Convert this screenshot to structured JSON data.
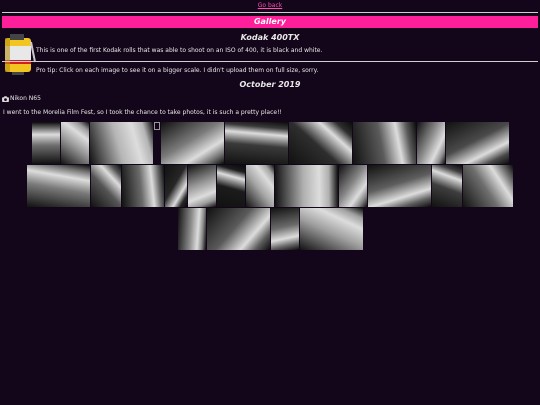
{
  "nav": {
    "go_back": "Go back"
  },
  "header": {
    "title": "Gallery"
  },
  "roll": {
    "title": "Kodak 400TX",
    "description": "This is one of the first Kodak rolls that was able to shoot on an ISO of 400, it is black and white.",
    "protip": "Pro tip: Click on each image to see it on a bigger scale. I didn't upload them on full size, sorry.",
    "film_icon": "film-canister-icon"
  },
  "section": {
    "date": "October 2019",
    "camera": "Nikon N65",
    "camera_icon": "camera-icon",
    "intro": "I went to the Morelia Film Fest, so I took the chance to take photos, it is such a pretty place!!"
  },
  "colors": {
    "accent": "#ff1f9a",
    "background": "#14061a",
    "link": "#ff4fb4"
  },
  "photos": [
    {
      "broken": false,
      "tone": "#6f6f6f",
      "w": 28
    },
    {
      "broken": false,
      "tone": "#9a9a9a",
      "w": 28
    },
    {
      "broken": false,
      "tone": "#b5b5b5",
      "w": 63
    },
    {
      "broken": true,
      "tone": "#000000",
      "w": 6
    },
    {
      "broken": false,
      "tone": "#7a7a7a",
      "w": 63
    },
    {
      "broken": false,
      "tone": "#3a3a3a",
      "w": 63
    },
    {
      "broken": false,
      "tone": "#2e2e2e",
      "w": 63
    },
    {
      "broken": false,
      "tone": "#5a5a5a",
      "w": 63
    },
    {
      "broken": false,
      "tone": "#8e8e8e",
      "w": 28
    },
    {
      "broken": false,
      "tone": "#4a4a4a",
      "w": 63
    },
    {
      "broken": false,
      "tone": "#7a7a7a",
      "w": 63
    },
    {
      "broken": false,
      "tone": "#555555",
      "w": 30
    },
    {
      "broken": false,
      "tone": "#6a6a6a",
      "w": 42
    },
    {
      "broken": false,
      "tone": "#262626",
      "w": 22
    },
    {
      "broken": false,
      "tone": "#9a9a9a",
      "w": 28
    },
    {
      "broken": false,
      "tone": "#1c1c1c",
      "w": 28
    },
    {
      "broken": false,
      "tone": "#a5a5a5",
      "w": 28
    },
    {
      "broken": false,
      "tone": "#b0b0b0",
      "w": 63
    },
    {
      "broken": false,
      "tone": "#858585",
      "w": 28
    },
    {
      "broken": false,
      "tone": "#5e5e5e",
      "w": 63
    },
    {
      "broken": false,
      "tone": "#3e3e3e",
      "w": 30
    },
    {
      "broken": false,
      "tone": "#6e6e6e",
      "w": 50
    },
    {
      "broken": false,
      "tone": "#8a8a8a",
      "w": 28
    },
    {
      "broken": false,
      "tone": "#5a5a5a",
      "w": 63
    },
    {
      "broken": false,
      "tone": "#6a6a6a",
      "w": 28
    },
    {
      "broken": false,
      "tone": "#a0a0a0",
      "w": 63
    }
  ]
}
